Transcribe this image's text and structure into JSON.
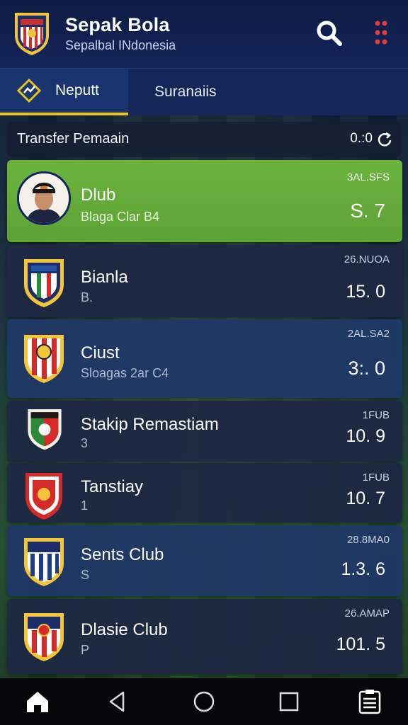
{
  "app": {
    "title": "Sepak Bola",
    "subtitle": "Sepalbal INdonesia"
  },
  "icons": {
    "logo": "club-shield-logo",
    "search": "search-icon",
    "menu": "more-vertical-icon"
  },
  "tabs": [
    {
      "label": "Neputt",
      "active": true,
      "icon": "chart-diamond-icon"
    },
    {
      "label": "Suranaiis",
      "active": false
    }
  ],
  "section": {
    "title": "Transfer Pemaain",
    "value": "0.:0",
    "icon": "refresh-icon"
  },
  "transfers": [
    {
      "name": "Dlub",
      "sub": "Blaga Clar B4",
      "date": "3AL.SFS",
      "value": "S. 7",
      "style": "green",
      "avatar": true
    },
    {
      "name": "Bianla",
      "sub": "B.",
      "date": "26.NUOA",
      "value": "15. 0",
      "style": "dark"
    },
    {
      "name": "Ciust",
      "sub": "Sloagas 2ar C4",
      "date": "2AL.SA2",
      "value": "3:. 0",
      "style": "blue"
    },
    {
      "name": "Stakip Remastiam",
      "sub": "3",
      "date": "1FUB",
      "value": "10. 9",
      "style": "dark"
    },
    {
      "name": "Tanstiay",
      "sub": "1",
      "date": "1FUB",
      "value": "10. 7",
      "style": "dark"
    },
    {
      "name": "Sents Club",
      "sub": "S",
      "date": "28.8MA0",
      "value": "1.3. 6",
      "style": "blue"
    },
    {
      "name": "Dlasie Club",
      "sub": "P",
      "date": "26.AMAP",
      "value": "101. 5",
      "style": "dark"
    }
  ],
  "colors": {
    "appbar": "#13245a",
    "tab_indicator": "#e6c21f",
    "highlight_row": "#6cb340",
    "menu_dots": "#e43b3b"
  },
  "navbar": [
    {
      "icon": "home-icon"
    },
    {
      "icon": "back-icon"
    },
    {
      "icon": "circle-home-icon"
    },
    {
      "icon": "recents-icon"
    },
    {
      "icon": "clipboard-icon"
    }
  ]
}
